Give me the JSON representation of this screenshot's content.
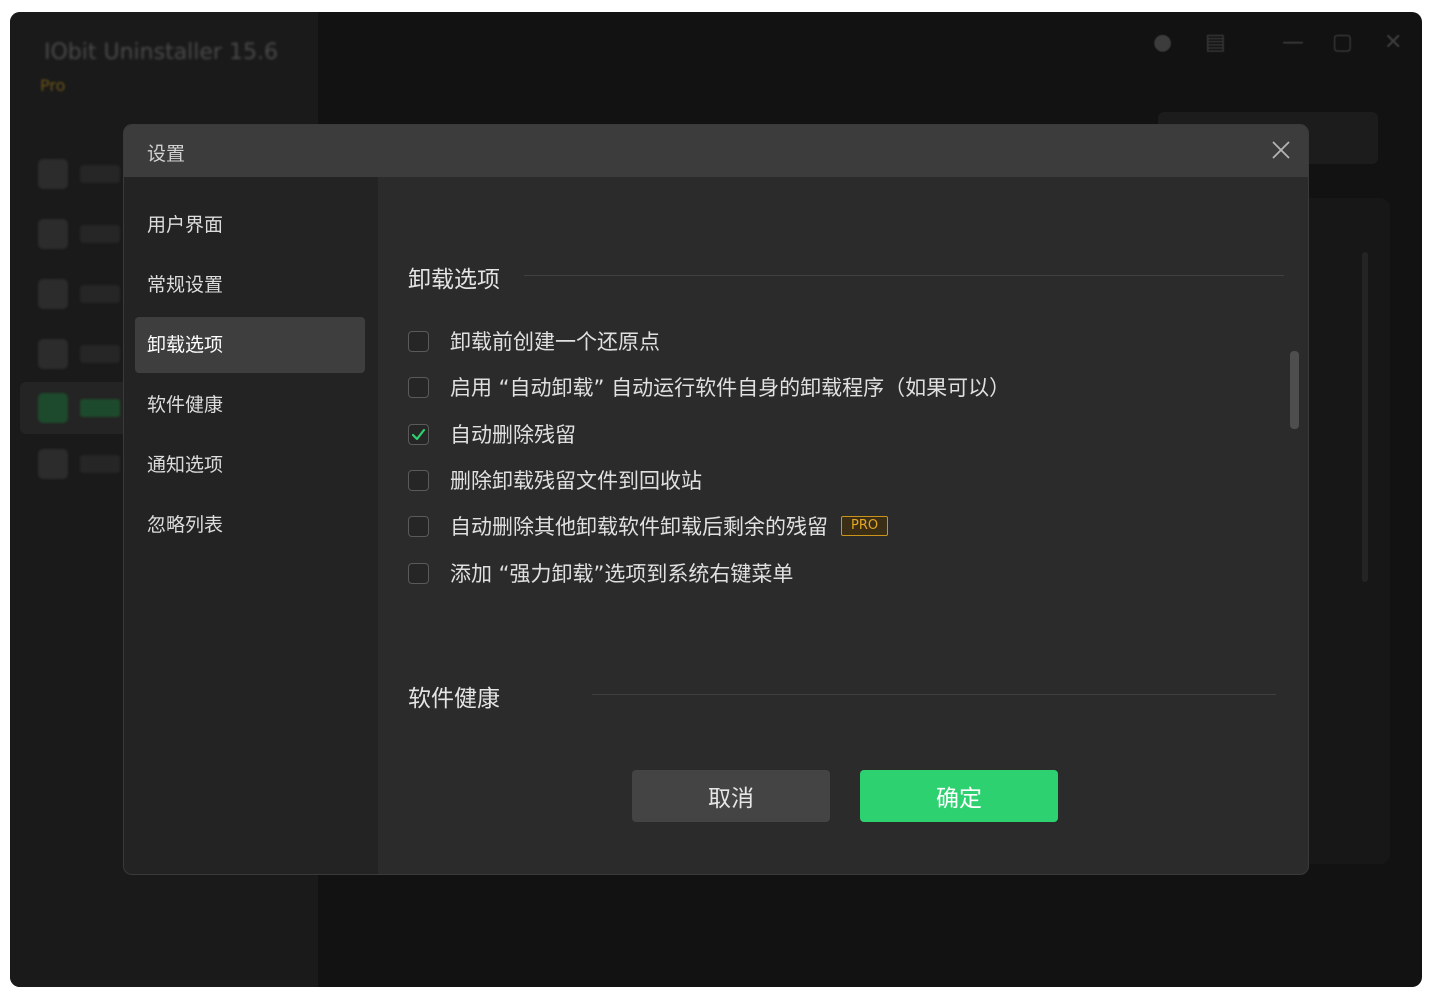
{
  "app": {
    "title": "IObit Uninstaller 15.6",
    "edition": "Pro"
  },
  "dialog": {
    "title": "设置",
    "sidebar": [
      {
        "label": "用户界面",
        "active": false
      },
      {
        "label": "常规设置",
        "active": false
      },
      {
        "label": "卸载选项",
        "active": true
      },
      {
        "label": "软件健康",
        "active": false
      },
      {
        "label": "通知选项",
        "active": false
      },
      {
        "label": "忽略列表",
        "active": false
      }
    ],
    "section_uninstall": {
      "title": "卸载选项",
      "options": [
        {
          "label": "卸载前创建一个还原点",
          "checked": false
        },
        {
          "label": "启用 “自动卸载” 自动运行软件自身的卸载程序（如果可以）",
          "checked": false
        },
        {
          "label": "自动删除残留",
          "checked": true
        },
        {
          "label": "删除卸载残留文件到回收站",
          "checked": false
        },
        {
          "label": "自动删除其他卸载软件卸载后剩余的残留",
          "checked": false,
          "badge": "PRO"
        },
        {
          "label": "添加 “强力卸载”选项到系统右键菜单",
          "checked": false
        }
      ]
    },
    "section_health": {
      "title": "软件健康"
    },
    "buttons": {
      "cancel": "取消",
      "ok": "确定"
    }
  },
  "colors": {
    "accent_green": "#2ed16f",
    "pro_badge": "#e5a624",
    "dialog_bg": "#2b2b2b",
    "header_bg": "#3c3c3c"
  }
}
